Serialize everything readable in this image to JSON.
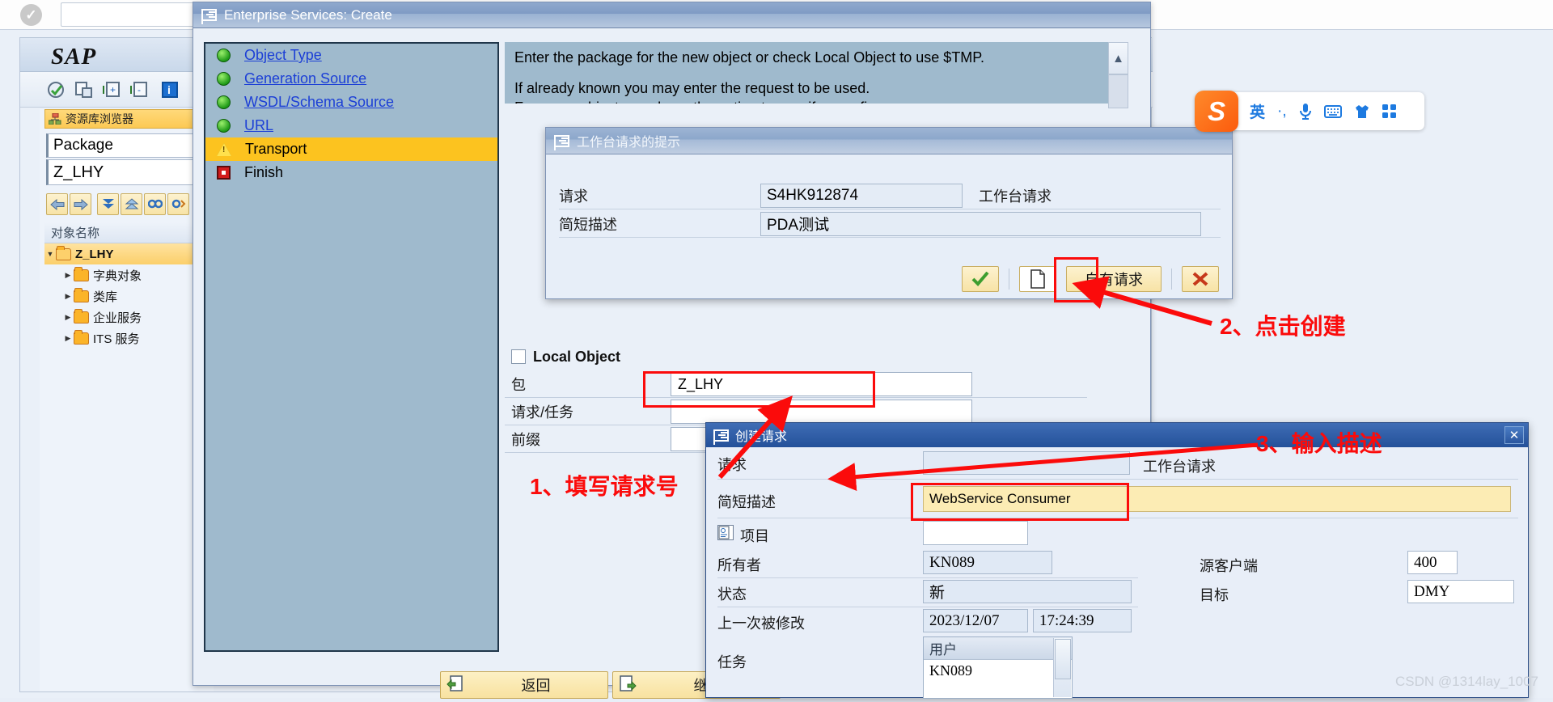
{
  "browser": {
    "check_icon": "check-circle-icon"
  },
  "sap": {
    "logo": "SAP",
    "toolbar_icons": [
      "clock-check-icon",
      "copy-object-icon",
      "expand-node-icon",
      "collapse-node-icon",
      "info-icon"
    ]
  },
  "repository": {
    "header": "资源库浏览器",
    "header_icon": "repository-icon",
    "type_label": "Package",
    "type_value": "Z_LHY",
    "nav_icons": [
      "back-arrow-icon",
      "forward-arrow-icon",
      "expand-all-icon",
      "collapse-all-icon",
      "find-icon",
      "find-next-icon"
    ],
    "column_header": "对象名称",
    "tree": [
      {
        "label": "Z_LHY",
        "level": 0,
        "expanded": true,
        "selected": true
      },
      {
        "label": "字典对象",
        "level": 1,
        "expanded": false,
        "selected": false
      },
      {
        "label": "类库",
        "level": 1,
        "expanded": false,
        "selected": false
      },
      {
        "label": "企业服务",
        "level": 1,
        "expanded": false,
        "selected": false
      },
      {
        "label": "ITS 服务",
        "level": 1,
        "expanded": false,
        "selected": false
      }
    ]
  },
  "wizard": {
    "title": "Enterprise Services: Create",
    "steps": [
      {
        "label": "Object Type",
        "state": "done",
        "link": true
      },
      {
        "label": "Generation Source",
        "state": "done",
        "link": true
      },
      {
        "label": "WSDL/Schema Source",
        "state": "done",
        "link": true
      },
      {
        "label": "URL",
        "state": "done",
        "link": true
      },
      {
        "label": "Transport",
        "state": "current",
        "link": false
      },
      {
        "label": "Finish",
        "state": "pending",
        "link": false
      }
    ],
    "instructions": [
      "Enter the package for the new object or check Local Object to use $TMP.",
      "If already known you may enter the request to be used.",
      "For proxy objects you have the option to specify a prefix."
    ],
    "local_object_label": "Local Object",
    "local_object_checked": false,
    "fields": [
      {
        "label": "包",
        "value": "Z_LHY"
      },
      {
        "label": "请求/任务",
        "value": ""
      },
      {
        "label": "前缀",
        "value": ""
      }
    ],
    "buttons": [
      {
        "label": "返回",
        "icon": "back-page-icon"
      },
      {
        "label": "继续",
        "icon": "next-page-icon"
      }
    ]
  },
  "workbench_dialog": {
    "title": "工作台请求的提示",
    "title_icon": "window-icon",
    "rows": [
      {
        "label": "请求",
        "value": "S4HK912874",
        "after": "工作台请求"
      },
      {
        "label": "简短描述",
        "value": "PDA测试",
        "after": ""
      }
    ],
    "buttons": [
      {
        "name": "confirm",
        "icon": "green-check-icon",
        "label": ""
      },
      {
        "name": "create-own-request",
        "icon": "new-document-icon",
        "label": ""
      },
      {
        "name": "own-request",
        "icon": "",
        "label": "自有请求"
      },
      {
        "name": "cancel",
        "icon": "red-x-icon",
        "label": ""
      }
    ]
  },
  "create_request_dialog": {
    "title": "创建请求",
    "title_icon": "window-icon",
    "close_icon": "close-icon",
    "request_label": "请求",
    "request_value": "",
    "request_after": "工作台请求",
    "short_desc_label": "简短描述",
    "short_desc_value": "WebService Consumer",
    "item_label": "项目",
    "item_icon": "item-icon",
    "item_value": "",
    "owner_label": "所有者",
    "owner_value": "KN089",
    "source_client_label": "源客户端",
    "source_client_value": "400",
    "status_label": "状态",
    "status_value": "新",
    "target_label": "目标",
    "target_value": "DMY",
    "last_changed_label": "上一次被修改",
    "last_changed_date": "2023/12/07",
    "last_changed_time": "17:24:39",
    "task_label": "任务",
    "task_col_header": "用户",
    "task_rows": [
      "KN089"
    ]
  },
  "ime": {
    "logo": "S",
    "items": [
      "英",
      "·,",
      "mic-icon",
      "keyboard-icon",
      "skin-icon",
      "apps-icon"
    ]
  },
  "annotations": [
    {
      "text": "1、填写请求号",
      "id": "annotation-1"
    },
    {
      "text": "2、点击创建",
      "id": "annotation-2"
    },
    {
      "text": "3、输入描述",
      "id": "annotation-3"
    }
  ],
  "watermark": "CSDN @1314lay_1007"
}
